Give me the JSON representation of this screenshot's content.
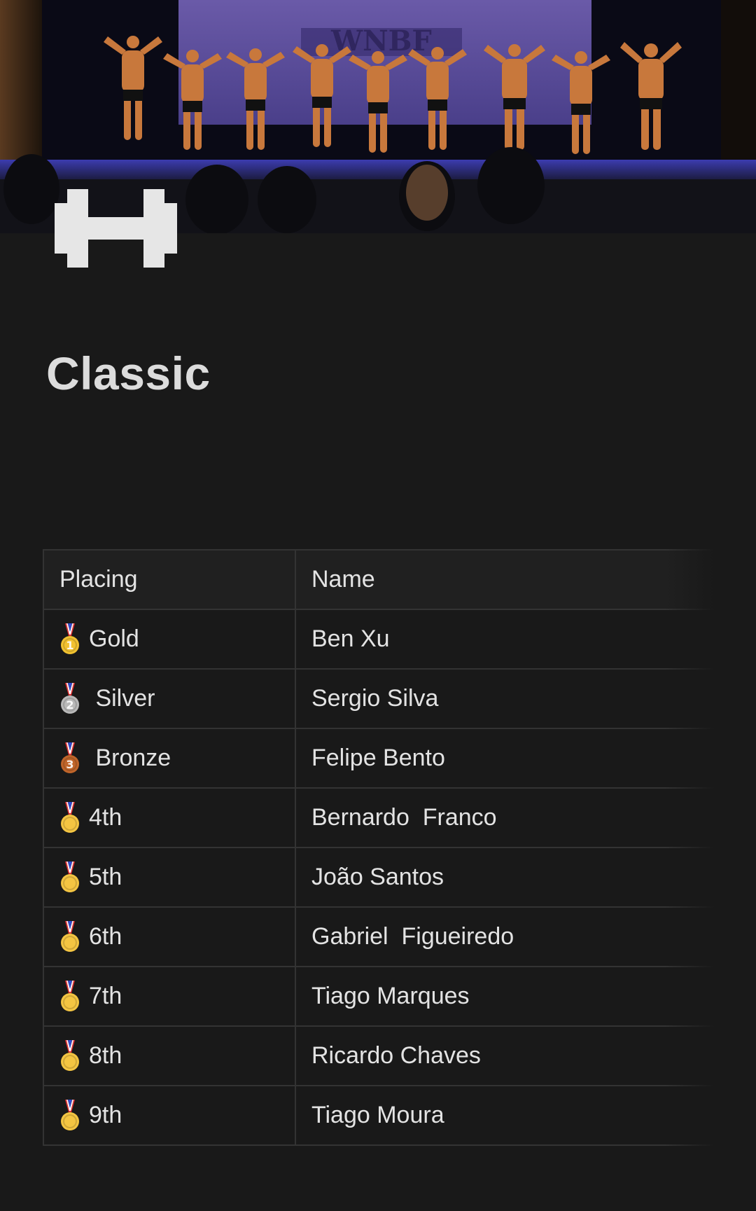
{
  "page": {
    "title": "Classic",
    "icon": "dumbbell-icon",
    "cover_image": "bodybuilding-stage-photo"
  },
  "table": {
    "headers": {
      "placing": "Placing",
      "name": "Name"
    },
    "rows": [
      {
        "medal": "gold-medal-icon",
        "medal_color": "#f2c230",
        "medal_number": "1",
        "placing": "Gold",
        "name": "Ben Xu"
      },
      {
        "medal": "silver-medal-icon",
        "medal_color": "#b9b9b9",
        "medal_number": "2",
        "placing": " Silver",
        "name": "Sergio Silva"
      },
      {
        "medal": "bronze-medal-icon",
        "medal_color": "#c0652a",
        "medal_number": "3",
        "placing": " Bronze",
        "name": "Felipe Bento"
      },
      {
        "medal": "sports-medal-icon",
        "medal_color": "#f4c542",
        "medal_number": "",
        "placing": "4th",
        "name": "Bernardo  Franco"
      },
      {
        "medal": "sports-medal-icon",
        "medal_color": "#f4c542",
        "medal_number": "",
        "placing": "5th",
        "name": "João Santos"
      },
      {
        "medal": "sports-medal-icon",
        "medal_color": "#f4c542",
        "medal_number": "",
        "placing": "6th",
        "name": "Gabriel  Figueiredo"
      },
      {
        "medal": "sports-medal-icon",
        "medal_color": "#f4c542",
        "medal_number": "",
        "placing": "7th",
        "name": "Tiago Marques"
      },
      {
        "medal": "sports-medal-icon",
        "medal_color": "#f4c542",
        "medal_number": "",
        "placing": "8th",
        "name": "Ricardo Chaves"
      },
      {
        "medal": "sports-medal-icon",
        "medal_color": "#f4c542",
        "medal_number": "",
        "placing": "9th",
        "name": "Tiago Moura"
      }
    ]
  },
  "colors": {
    "background": "#191919",
    "text": "#e3e3e3",
    "border": "#333333",
    "header_bg": "#202020"
  }
}
